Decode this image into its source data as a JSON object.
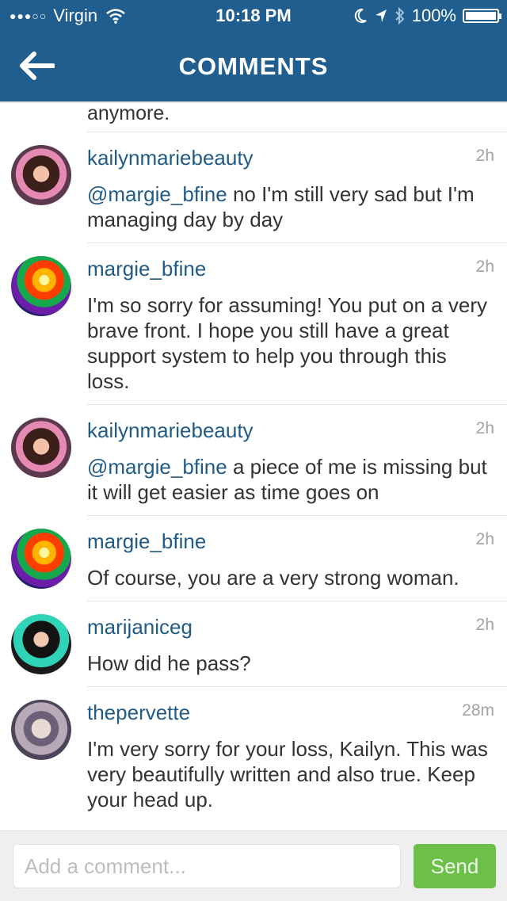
{
  "status_bar": {
    "carrier": "Virgin",
    "time": "10:18 PM",
    "battery": "100%",
    "battery_level": 1.0
  },
  "navbar": {
    "title": "COMMENTS",
    "back_icon": "arrow-left-icon"
  },
  "partial_comment_text": "anymore.",
  "comments": [
    {
      "username": "kailynmariebeauty",
      "time": "2h",
      "mention": "@margie_bfine",
      "text": " no I'm still very sad but I'm managing day by day"
    },
    {
      "username": "margie_bfine",
      "time": "2h",
      "mention": "",
      "text": "I'm so sorry for assuming! You put on a very brave front. I hope you still have  a great support system to help you through this loss."
    },
    {
      "username": "kailynmariebeauty",
      "time": "2h",
      "mention": "@margie_bfine",
      "text": " a piece of me is missing but it will get easier as time goes on"
    },
    {
      "username": "margie_bfine",
      "time": "2h",
      "mention": "",
      "text": "Of course, you are a very strong woman."
    },
    {
      "username": "marijaniceg",
      "time": "2h",
      "mention": "",
      "text": "How did he pass?"
    },
    {
      "username": "thepervette",
      "time": "28m",
      "mention": "",
      "text": "I'm very sorry for your loss, Kailyn. This was very beautifully written and also true. Keep your head up."
    }
  ],
  "footer": {
    "placeholder": "Add a comment...",
    "send_label": "Send",
    "send_color": "#6cc04a"
  },
  "colors": {
    "header": "#1f5e8e",
    "username": "#215b86"
  }
}
